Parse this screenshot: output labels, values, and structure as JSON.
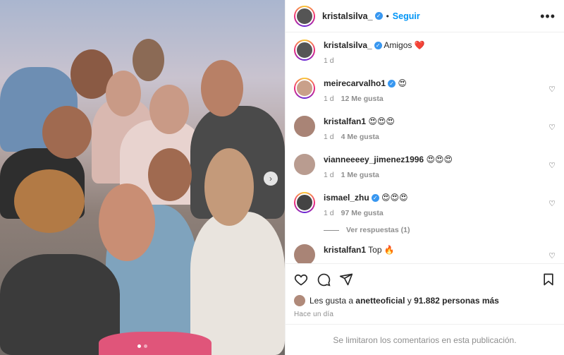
{
  "post": {
    "author": "kristalsilva_",
    "follow_label": "Seguir",
    "separator": "•",
    "more_icon": "more-horizontal-icon",
    "image_alt": "Group photo of friends"
  },
  "caption": {
    "user": "kristalsilva_",
    "text": "Amigos",
    "emoji": "❤️",
    "time": "1 d"
  },
  "comments": [
    {
      "user": "meirecarvalho1",
      "verified": true,
      "text": "😍",
      "time": "1 d",
      "likes": "12 Me gusta"
    },
    {
      "user": "kristalfan1",
      "verified": false,
      "text": "😍😍😍",
      "time": "1 d",
      "likes": "4 Me gusta"
    },
    {
      "user": "vianneeeey_jimenez1996",
      "verified": false,
      "text": "😍😍😍",
      "time": "1 d",
      "likes": "1 Me gusta"
    },
    {
      "user": "ismael_zhu",
      "verified": true,
      "text": "😍😍😍",
      "time": "1 d",
      "likes": "97 Me gusta"
    },
    {
      "user": "kristalfan1",
      "verified": false,
      "text": "Top 🔥",
      "time": "",
      "likes": ""
    }
  ],
  "replies_label": "Ver respuestas (1)",
  "likes": {
    "prefix": "Les gusta a",
    "user": "anetteoficial",
    "connector": "y",
    "others": "91.882 personas más"
  },
  "timestamp": "Hace un día",
  "footer": "Se limitaron los comentarios en esta publicación.",
  "colors": {
    "accent": "#0095f6",
    "verified": "#3897f0",
    "text": "#262626",
    "muted": "#8e8e8e"
  }
}
